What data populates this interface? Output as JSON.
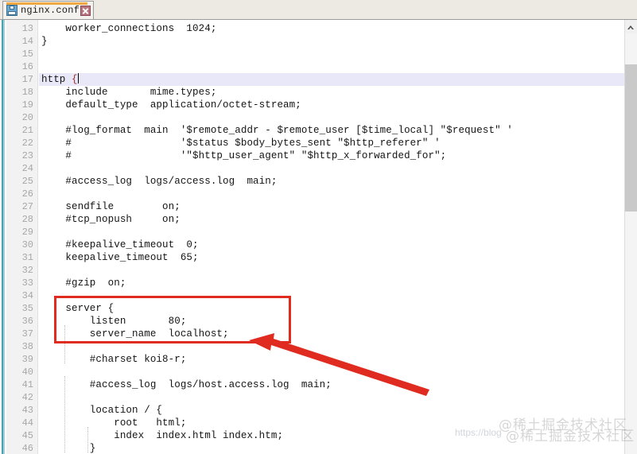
{
  "window": {
    "title": "nginx.conf"
  },
  "tabbar": {
    "tabs": [
      {
        "label": "nginx.conf",
        "icon": "floppy-disk-icon",
        "close_label": "×",
        "modified_accent": "#f0a843"
      }
    ]
  },
  "editor": {
    "first_visible_line": 13,
    "last_visible_line": 46,
    "highlighted_line": 17,
    "caret_line": 17,
    "lines": [
      {
        "n": 13,
        "text": "    worker_connections  1024;"
      },
      {
        "n": 14,
        "text": "}"
      },
      {
        "n": 15,
        "text": ""
      },
      {
        "n": 16,
        "text": ""
      },
      {
        "n": 17,
        "text": "http {"
      },
      {
        "n": 18,
        "text": "    include       mime.types;"
      },
      {
        "n": 19,
        "text": "    default_type  application/octet-stream;"
      },
      {
        "n": 20,
        "text": ""
      },
      {
        "n": 21,
        "text": "    #log_format  main  '$remote_addr - $remote_user [$time_local] \"$request\" '"
      },
      {
        "n": 22,
        "text": "    #                  '$status $body_bytes_sent \"$http_referer\" '"
      },
      {
        "n": 23,
        "text": "    #                  '\"$http_user_agent\" \"$http_x_forwarded_for\";"
      },
      {
        "n": 24,
        "text": ""
      },
      {
        "n": 25,
        "text": "    #access_log  logs/access.log  main;"
      },
      {
        "n": 26,
        "text": ""
      },
      {
        "n": 27,
        "text": "    sendfile        on;"
      },
      {
        "n": 28,
        "text": "    #tcp_nopush     on;"
      },
      {
        "n": 29,
        "text": ""
      },
      {
        "n": 30,
        "text": "    #keepalive_timeout  0;"
      },
      {
        "n": 31,
        "text": "    keepalive_timeout  65;"
      },
      {
        "n": 32,
        "text": ""
      },
      {
        "n": 33,
        "text": "    #gzip  on;"
      },
      {
        "n": 34,
        "text": ""
      },
      {
        "n": 35,
        "text": "    server {"
      },
      {
        "n": 36,
        "text": "        listen       80;"
      },
      {
        "n": 37,
        "text": "        server_name  localhost;"
      },
      {
        "n": 38,
        "text": ""
      },
      {
        "n": 39,
        "text": "        #charset koi8-r;"
      },
      {
        "n": 40,
        "text": ""
      },
      {
        "n": 41,
        "text": "        #access_log  logs/host.access.log  main;"
      },
      {
        "n": 42,
        "text": ""
      },
      {
        "n": 43,
        "text": "        location / {"
      },
      {
        "n": 44,
        "text": "            root   html;"
      },
      {
        "n": 45,
        "text": "            index  index.html index.htm;"
      },
      {
        "n": 46,
        "text": "        }"
      }
    ]
  },
  "annotations": {
    "highlight_box": {
      "name": "server-block-highlight",
      "color": "#e02b20",
      "covers_lines": [
        35,
        36,
        37
      ]
    },
    "arrow": {
      "name": "pointer-arrow",
      "color": "#e02b20",
      "points_to": "server block"
    }
  },
  "scrollbar": {
    "orientation": "vertical",
    "up_arrow": "chevron-up-icon"
  },
  "watermark": {
    "text_primary": "@稀土掘金技术社区",
    "text_secondary": "@稀土掘金技术社区",
    "url": "https://blog"
  }
}
